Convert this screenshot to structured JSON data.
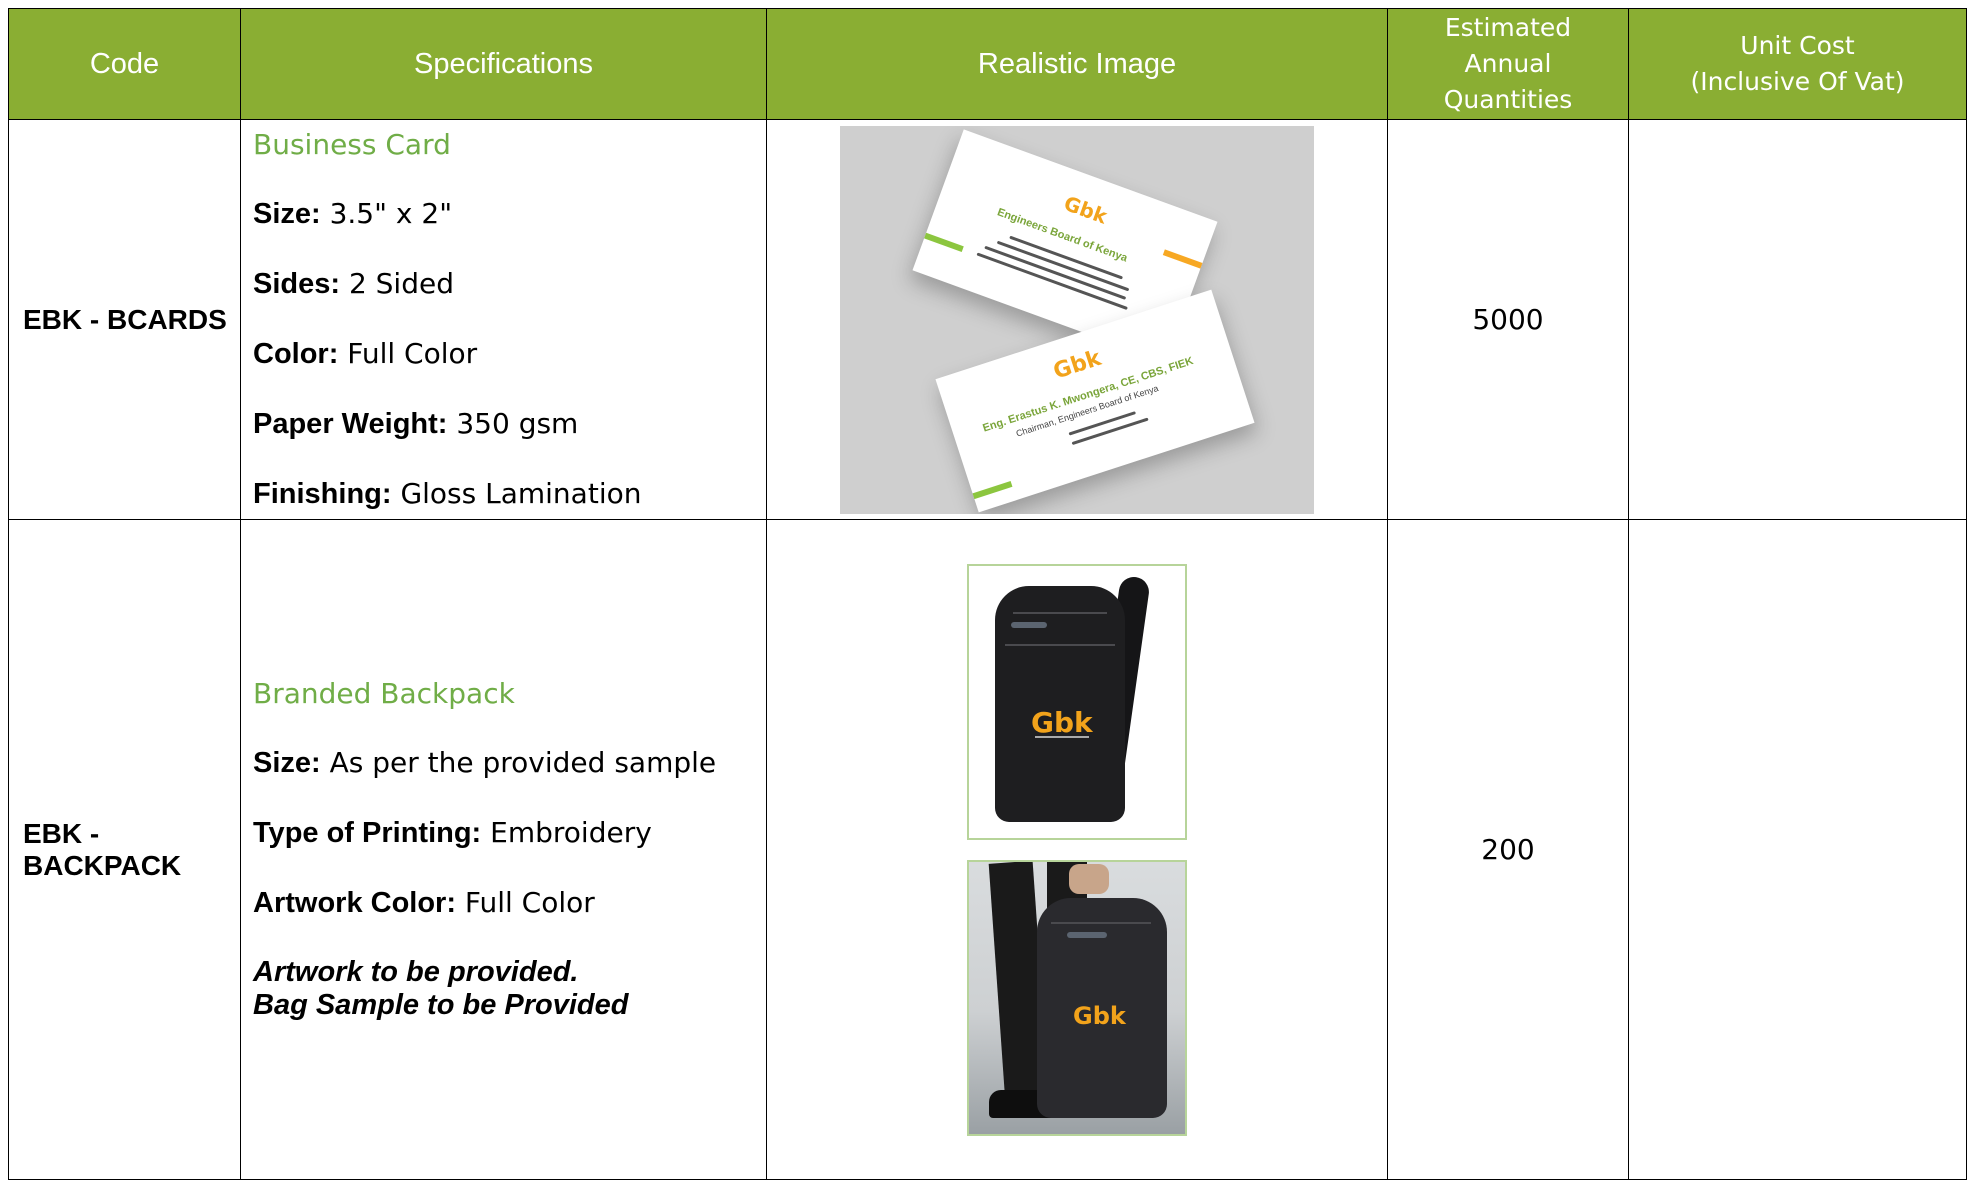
{
  "table": {
    "headers": {
      "code": "Code",
      "specifications": "Specifications",
      "realistic_image": "Realistic Image",
      "estimated_annual_quantities": [
        "Estimated",
        "Annual",
        "Quantities"
      ],
      "unit_cost": [
        "Unit Cost",
        "(Inclusive Of Vat)"
      ]
    },
    "rows": [
      {
        "code": "EBK - BCARDS",
        "title": "Business Card",
        "specs": [
          {
            "label": "Size:",
            "value": "3.5\" x 2\""
          },
          {
            "label": "Sides:",
            "value": "2 Sided"
          },
          {
            "label": "Color:",
            "value": "Full Color"
          },
          {
            "label": "Paper Weight:",
            "value": "350 gsm"
          },
          {
            "label": "Finishing:",
            "value": "Gloss Lamination"
          }
        ],
        "quantity": "5000",
        "unit_cost": "",
        "image": {
          "card_front_org": "Engineers Board of Kenya",
          "card_back_name": "Eng. Erastus K. Mwongera, CE, CBS, FIEK",
          "card_back_role": "Chairman, Engineers Board of Kenya",
          "logo_text": "Gbk"
        }
      },
      {
        "code_lines": [
          "EBK -",
          "BACKPACK"
        ],
        "title": "Branded Backpack",
        "specs": [
          {
            "label": "Size:",
            "value": "As per the provided sample"
          },
          {
            "label": "Type of Printing:",
            "value": "Embroidery"
          },
          {
            "label": "Artwork Color:",
            "value": "Full Color"
          }
        ],
        "notes": [
          "Artwork to be provided.",
          "Bag Sample to be Provided"
        ],
        "quantity": "200",
        "unit_cost": "",
        "image": {
          "logo_text": "Gbk"
        }
      }
    ]
  },
  "colors": {
    "header_bg": "#8aae33",
    "title_green": "#70ad47",
    "logo_orange": "#f2a31b"
  }
}
